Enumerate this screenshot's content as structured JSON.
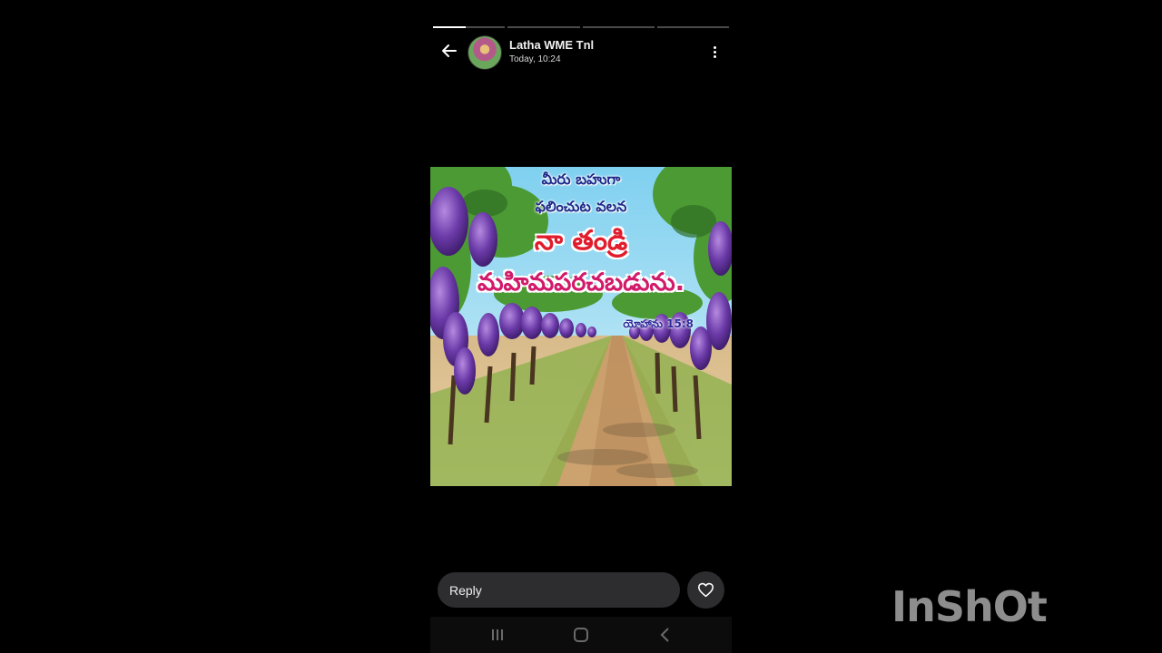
{
  "story": {
    "user_name": "Latha WME Tnl",
    "timestamp": "Today, 10:24",
    "segments": [
      0.45,
      0,
      0,
      0
    ],
    "image": {
      "line1": "మీరు బహుగా",
      "line2": "ఫలించుట వలన",
      "line3": "నా తండ్రి",
      "line4": "మహిమపరచబడును.",
      "reference": "యోహాను 15:8"
    }
  },
  "footer": {
    "reply_placeholder": "Reply"
  },
  "icons": {
    "back": "arrow-left-icon",
    "more": "more-vertical-icon",
    "heart": "heart-outline-icon",
    "recents": "recents-icon",
    "home": "home-icon",
    "nav_back": "chevron-left-icon"
  },
  "watermark": "InShOt",
  "colors": {
    "background": "#000000",
    "pill": "#2d2d2f",
    "heading_red": "#e11c2c",
    "heading_blue": "#1e2a8a"
  }
}
